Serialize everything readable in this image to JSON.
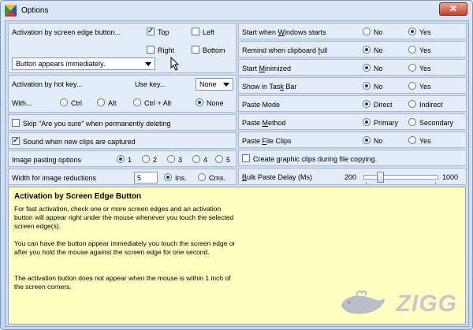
{
  "window": {
    "title": "Options",
    "close_glyph": "✕",
    "icon": "colored-triangles-icon"
  },
  "left": {
    "edge": {
      "label": "Activation by screen edge button...",
      "top": "Top",
      "left": "Left",
      "right": "Right",
      "bottom": "Bottom",
      "checked": [
        "Top"
      ],
      "dropdown_value": "Button appears immediately."
    },
    "hotkey": {
      "label": "Activation by hot key...",
      "use_key_label": "Use key...",
      "use_key_value": "None",
      "with_label": "With...",
      "options": [
        "Ctrl",
        "Alt",
        "Ctrl + Alt",
        "None"
      ],
      "selected": "None"
    },
    "skip_label": "Skip \"Are you sure\" when permanently deleting",
    "skip_checked": false,
    "sound_label": "Sound when new clips are captured",
    "sound_checked": true,
    "image_paste": {
      "label": "Image pasting options",
      "options": [
        "1",
        "2",
        "3",
        "4",
        "5"
      ],
      "selected": "1"
    },
    "width": {
      "label": "Width for image reductions",
      "value": "5",
      "ins": "Ins.",
      "cms": "Cms.",
      "selected": "Ins."
    }
  },
  "right": {
    "rows": [
      {
        "label_pre": "Start when ",
        "label_u": "W",
        "label_post": "indows starts",
        "opt1": "No",
        "opt2": "Yes",
        "selected": "Yes"
      },
      {
        "label_pre": "Remind when clipboard ",
        "label_u": "f",
        "label_post": "ull",
        "opt1": "No",
        "opt2": "Yes",
        "selected": "No"
      },
      {
        "label_pre": "Start ",
        "label_u": "M",
        "label_post": "inimized",
        "opt1": "No",
        "opt2": "Yes",
        "selected": "No"
      },
      {
        "label_pre": "Show in Tas",
        "label_u": "k",
        "label_post": " Bar",
        "opt1": "No",
        "opt2": "Yes",
        "selected": "No"
      },
      {
        "label_pre": "Paste Mode",
        "label_u": "",
        "label_post": "",
        "opt1": "Direct",
        "opt2": "Indirect",
        "selected": "Direct"
      },
      {
        "label_pre": "Paste ",
        "label_u": "M",
        "label_post": "ethod",
        "opt1": "Primary",
        "opt2": "Secondary",
        "selected": "Primary"
      },
      {
        "label_pre": "Paste ",
        "label_u": "F",
        "label_post": "ile Clips",
        "opt1": "No",
        "opt2": "Yes",
        "selected": "No"
      }
    ],
    "graphic_label": "Create graphic clips during file copying.",
    "graphic_checked": false,
    "bulk": {
      "label_u": "B",
      "label_post": "ulk Paste Delay (Ms)",
      "min": "200",
      "max": "1000",
      "value": 0.2
    }
  },
  "help": {
    "title": "Activation by Screen Edge Button",
    "p1": "For fast activation, check one or more screen edges and an activation button will appear right under the mouse whenever you touch the selected screen edge(s).",
    "p2": "You can have the button appear immediately you touch the screen edge or after you hold the mouse against the screen edge for one second.",
    "p3": "The activation button does not appear when the mouse is within 1 inch of the screen corners."
  },
  "watermark": "ZIGG"
}
